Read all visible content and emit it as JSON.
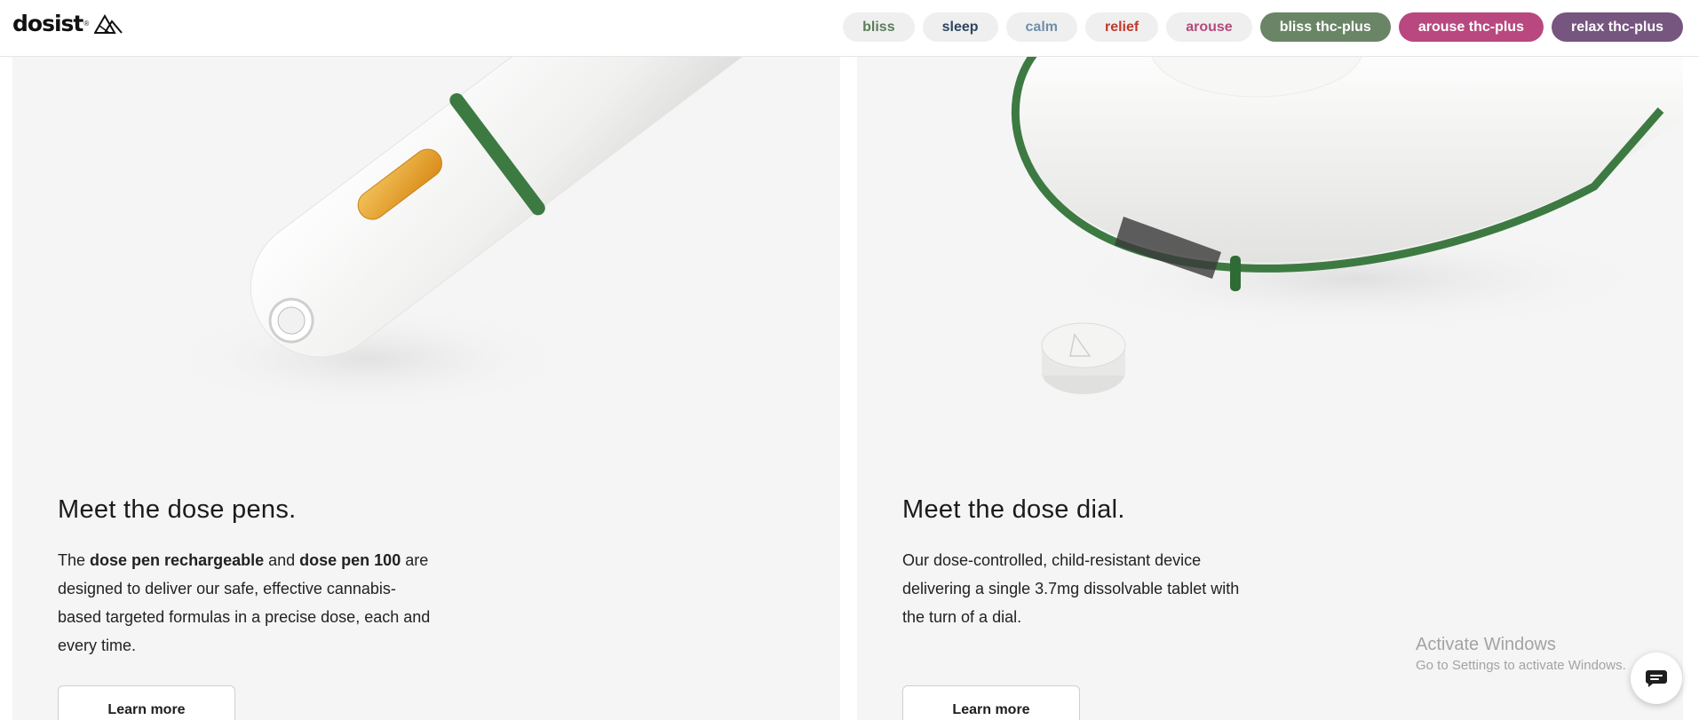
{
  "brand": {
    "name": "dosist",
    "registered_mark": "®"
  },
  "nav": {
    "pills": [
      {
        "label": "bliss",
        "color": "#5e7d5b",
        "bg": "#efefef",
        "style": "light"
      },
      {
        "label": "sleep",
        "color": "#2e4560",
        "bg": "#efefef",
        "style": "light"
      },
      {
        "label": "calm",
        "color": "#6f8fa8",
        "bg": "#efefef",
        "style": "light"
      },
      {
        "label": "relief",
        "color": "#c0392b",
        "bg": "#efefef",
        "style": "light"
      },
      {
        "label": "arouse",
        "color": "#b44a7c",
        "bg": "#efefef",
        "style": "light"
      },
      {
        "label": "bliss thc-plus",
        "color": "#ffffff",
        "bg": "#6a8566",
        "style": "filled"
      },
      {
        "label": "arouse thc-plus",
        "color": "#ffffff",
        "bg": "#b8487f",
        "style": "filled"
      },
      {
        "label": "relax thc-plus",
        "color": "#ffffff",
        "bg": "#76557f",
        "style": "filled"
      }
    ]
  },
  "cards": {
    "pens": {
      "title": "Meet the dose pens.",
      "body_pre": "The ",
      "body_bold_1": "dose pen rechargeable",
      "body_mid": " and ",
      "body_bold_2": "dose pen 100",
      "body_post": " are designed to deliver our safe, effective cannabis-based targeted formulas in a precise dose, each and every time.",
      "cta": "Learn more"
    },
    "dial": {
      "title": "Meet the dose dial.",
      "body": "Our dose-controlled, child-resistant device delivering a single 3.7mg dissolvable tablet with the turn of a dial.",
      "cta": "Learn more"
    }
  },
  "watermark": {
    "title": "Activate Windows",
    "subtitle": "Go to Settings to activate Windows."
  },
  "icons": {
    "logo_mark": "mountain-logo-icon",
    "chat": "chat-bubble-icon"
  },
  "colors": {
    "accent_green": "#3d7a42",
    "card_bg": "#f5f5f5"
  }
}
